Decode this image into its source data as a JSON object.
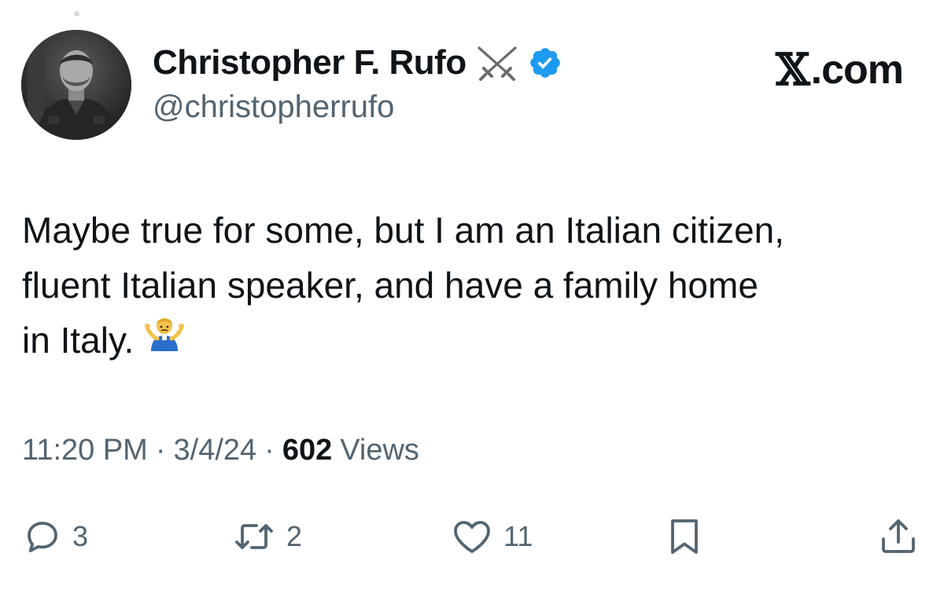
{
  "author": {
    "display_name": "Christopher F. Rufo",
    "handle": "@christopherrufo",
    "badge_icon": "crossed-swords-icon",
    "verified_icon": "verified-badge-icon",
    "verified_color": "#1d9bf0"
  },
  "brand": {
    "x_mark": "𝕏",
    "suffix": ".com"
  },
  "tweet": {
    "lines": [
      "Maybe true for some, but I am an Italian citizen,",
      "fluent Italian speaker, and have a family home",
      "in Italy."
    ],
    "emoji": "person-shrugging-emoji"
  },
  "meta": {
    "time": "11:20 PM",
    "separator": "·",
    "date": "3/4/24",
    "views_count": "602",
    "views_label": "Views"
  },
  "actions": {
    "replies": "3",
    "reposts": "2",
    "likes": "11"
  },
  "colors": {
    "text": "#0f1419",
    "secondary": "#536471",
    "background": "#ffffff"
  }
}
